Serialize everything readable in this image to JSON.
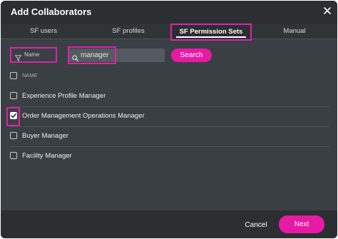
{
  "dialog": {
    "title": "Add Collaborators"
  },
  "tabs": [
    {
      "label": "SF users"
    },
    {
      "label": "SF profiles"
    },
    {
      "label": "SF Permission Sets"
    },
    {
      "label": "Manual"
    }
  ],
  "filter": {
    "label": "Name"
  },
  "search": {
    "value": "manager",
    "button_label": "Search"
  },
  "table": {
    "column_header": "NAME",
    "rows": [
      {
        "label": "Experience Profile Manager",
        "checked": false
      },
      {
        "label": "Order Management Operations Manager",
        "checked": true
      },
      {
        "label": "Buyer Manager",
        "checked": false
      },
      {
        "label": "Facility Manager",
        "checked": false
      }
    ]
  },
  "footer": {
    "cancel_label": "Cancel",
    "next_label": "Next"
  },
  "colors": {
    "accent": "#e71aa6",
    "highlight": "#e020b0",
    "background": "#3a3f43"
  },
  "icons": {
    "close": "close-icon",
    "filter": "filter-icon",
    "search": "search-icon",
    "check": "check-icon"
  }
}
